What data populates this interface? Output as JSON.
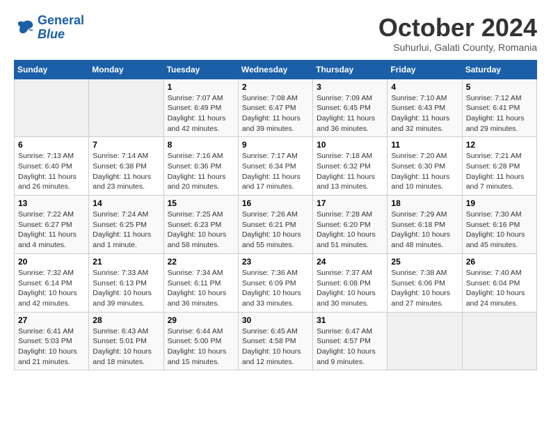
{
  "logo": {
    "line1": "General",
    "line2": "Blue"
  },
  "title": "October 2024",
  "subtitle": "Suhurlui, Galati County, Romania",
  "headers": [
    "Sunday",
    "Monday",
    "Tuesday",
    "Wednesday",
    "Thursday",
    "Friday",
    "Saturday"
  ],
  "weeks": [
    [
      {
        "day": "",
        "info": ""
      },
      {
        "day": "",
        "info": ""
      },
      {
        "day": "1",
        "info": "Sunrise: 7:07 AM\nSunset: 6:49 PM\nDaylight: 11 hours and 42 minutes."
      },
      {
        "day": "2",
        "info": "Sunrise: 7:08 AM\nSunset: 6:47 PM\nDaylight: 11 hours and 39 minutes."
      },
      {
        "day": "3",
        "info": "Sunrise: 7:09 AM\nSunset: 6:45 PM\nDaylight: 11 hours and 36 minutes."
      },
      {
        "day": "4",
        "info": "Sunrise: 7:10 AM\nSunset: 6:43 PM\nDaylight: 11 hours and 32 minutes."
      },
      {
        "day": "5",
        "info": "Sunrise: 7:12 AM\nSunset: 6:41 PM\nDaylight: 11 hours and 29 minutes."
      }
    ],
    [
      {
        "day": "6",
        "info": "Sunrise: 7:13 AM\nSunset: 6:40 PM\nDaylight: 11 hours and 26 minutes."
      },
      {
        "day": "7",
        "info": "Sunrise: 7:14 AM\nSunset: 6:38 PM\nDaylight: 11 hours and 23 minutes."
      },
      {
        "day": "8",
        "info": "Sunrise: 7:16 AM\nSunset: 6:36 PM\nDaylight: 11 hours and 20 minutes."
      },
      {
        "day": "9",
        "info": "Sunrise: 7:17 AM\nSunset: 6:34 PM\nDaylight: 11 hours and 17 minutes."
      },
      {
        "day": "10",
        "info": "Sunrise: 7:18 AM\nSunset: 6:32 PM\nDaylight: 11 hours and 13 minutes."
      },
      {
        "day": "11",
        "info": "Sunrise: 7:20 AM\nSunset: 6:30 PM\nDaylight: 11 hours and 10 minutes."
      },
      {
        "day": "12",
        "info": "Sunrise: 7:21 AM\nSunset: 6:28 PM\nDaylight: 11 hours and 7 minutes."
      }
    ],
    [
      {
        "day": "13",
        "info": "Sunrise: 7:22 AM\nSunset: 6:27 PM\nDaylight: 11 hours and 4 minutes."
      },
      {
        "day": "14",
        "info": "Sunrise: 7:24 AM\nSunset: 6:25 PM\nDaylight: 11 hours and 1 minute."
      },
      {
        "day": "15",
        "info": "Sunrise: 7:25 AM\nSunset: 6:23 PM\nDaylight: 10 hours and 58 minutes."
      },
      {
        "day": "16",
        "info": "Sunrise: 7:26 AM\nSunset: 6:21 PM\nDaylight: 10 hours and 55 minutes."
      },
      {
        "day": "17",
        "info": "Sunrise: 7:28 AM\nSunset: 6:20 PM\nDaylight: 10 hours and 51 minutes."
      },
      {
        "day": "18",
        "info": "Sunrise: 7:29 AM\nSunset: 6:18 PM\nDaylight: 10 hours and 48 minutes."
      },
      {
        "day": "19",
        "info": "Sunrise: 7:30 AM\nSunset: 6:16 PM\nDaylight: 10 hours and 45 minutes."
      }
    ],
    [
      {
        "day": "20",
        "info": "Sunrise: 7:32 AM\nSunset: 6:14 PM\nDaylight: 10 hours and 42 minutes."
      },
      {
        "day": "21",
        "info": "Sunrise: 7:33 AM\nSunset: 6:13 PM\nDaylight: 10 hours and 39 minutes."
      },
      {
        "day": "22",
        "info": "Sunrise: 7:34 AM\nSunset: 6:11 PM\nDaylight: 10 hours and 36 minutes."
      },
      {
        "day": "23",
        "info": "Sunrise: 7:36 AM\nSunset: 6:09 PM\nDaylight: 10 hours and 33 minutes."
      },
      {
        "day": "24",
        "info": "Sunrise: 7:37 AM\nSunset: 6:08 PM\nDaylight: 10 hours and 30 minutes."
      },
      {
        "day": "25",
        "info": "Sunrise: 7:38 AM\nSunset: 6:06 PM\nDaylight: 10 hours and 27 minutes."
      },
      {
        "day": "26",
        "info": "Sunrise: 7:40 AM\nSunset: 6:04 PM\nDaylight: 10 hours and 24 minutes."
      }
    ],
    [
      {
        "day": "27",
        "info": "Sunrise: 6:41 AM\nSunset: 5:03 PM\nDaylight: 10 hours and 21 minutes."
      },
      {
        "day": "28",
        "info": "Sunrise: 6:43 AM\nSunset: 5:01 PM\nDaylight: 10 hours and 18 minutes."
      },
      {
        "day": "29",
        "info": "Sunrise: 6:44 AM\nSunset: 5:00 PM\nDaylight: 10 hours and 15 minutes."
      },
      {
        "day": "30",
        "info": "Sunrise: 6:45 AM\nSunset: 4:58 PM\nDaylight: 10 hours and 12 minutes."
      },
      {
        "day": "31",
        "info": "Sunrise: 6:47 AM\nSunset: 4:57 PM\nDaylight: 10 hours and 9 minutes."
      },
      {
        "day": "",
        "info": ""
      },
      {
        "day": "",
        "info": ""
      }
    ]
  ]
}
